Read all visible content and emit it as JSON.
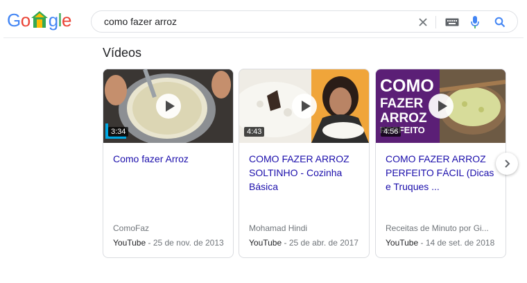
{
  "logo": {
    "letters": [
      "G",
      "o",
      "",
      "g",
      "l",
      "e"
    ],
    "colors": {
      "blue": "#4285f4",
      "red": "#ea4335",
      "yellow": "#fbbc05",
      "green": "#34a853"
    }
  },
  "search": {
    "query": "como fazer arroz",
    "icons": [
      "close-icon",
      "keyboard-icon",
      "microphone-icon",
      "search-icon"
    ]
  },
  "section": {
    "title": "Vídeos"
  },
  "videos": [
    {
      "duration": "3:34",
      "title": "Como fazer Arroz",
      "channel": "ComoFaz",
      "source": "YouTube",
      "date": " - 25 de nov. de 2013"
    },
    {
      "duration": "4:43",
      "title": "COMO FAZER ARROZ SOLTINHO - Cozinha Básica",
      "channel": "Mohamad Hindi",
      "source": "YouTube",
      "date": " - 25 de abr. de 2017"
    },
    {
      "duration": "4:56",
      "thumb_text": "COMO FAZER ARROZ PERFEITO",
      "title": "COMO FAZER ARROZ PERFEITO FÁCIL (Dicas e Truques ...",
      "channel": "Receitas de Minuto por Gi...",
      "source": "YouTube",
      "date": " - 14 de set. de 2018"
    }
  ],
  "next_icon": "chevron-right-icon",
  "colors": {
    "link": "#1a0dab",
    "thumb_purple": "#5b1f76"
  }
}
